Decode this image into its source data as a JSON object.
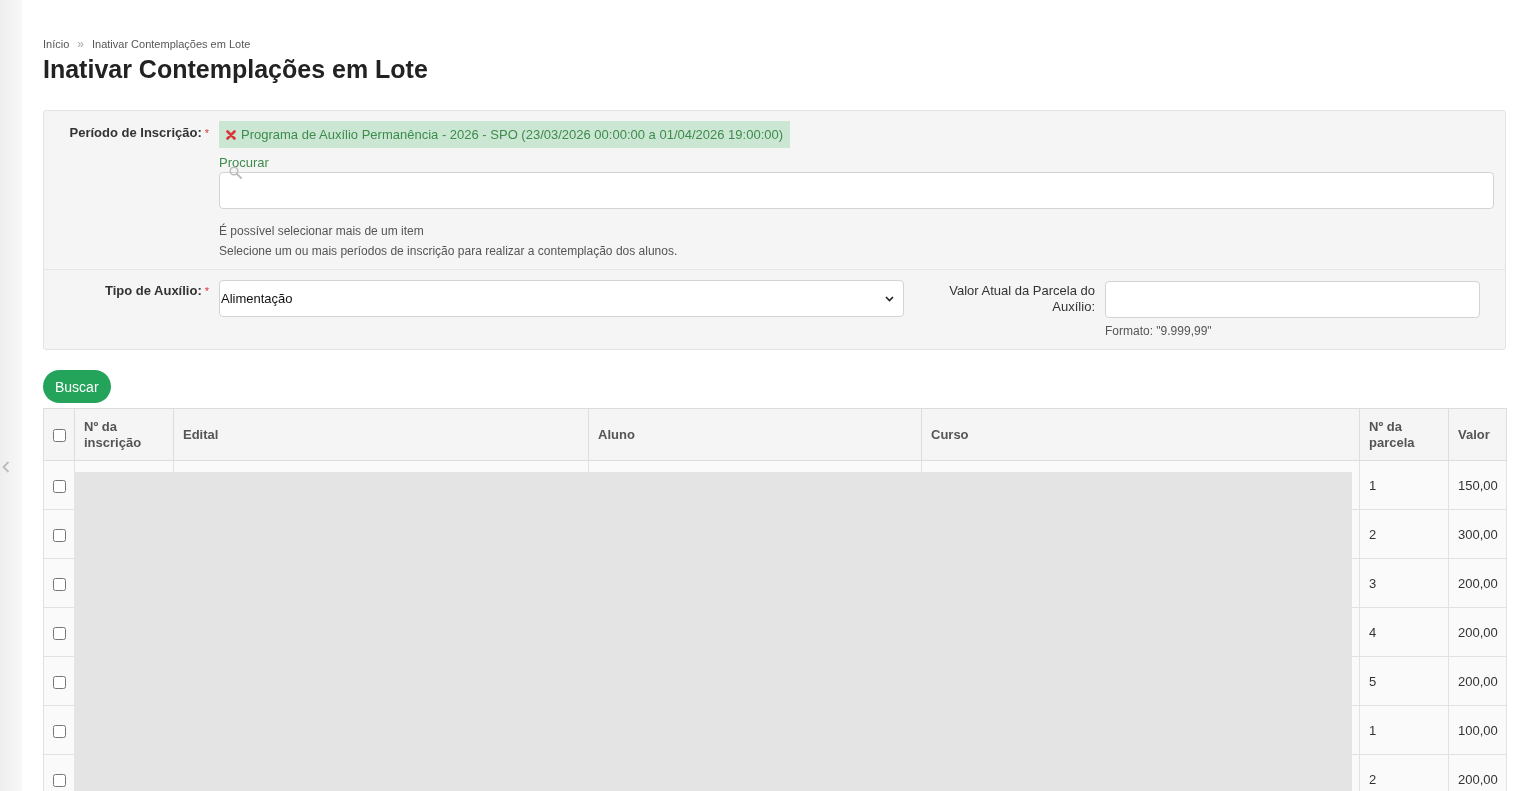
{
  "breadcrumb": {
    "items": [
      {
        "label": "Início"
      },
      {
        "label": "Inativar Contemplações em Lote"
      }
    ],
    "separator": "»"
  },
  "title": "Inativar Contemplações em Lote",
  "filters": {
    "enrollment_period": {
      "label": "Período de Inscrição:",
      "required_mark": "*",
      "selected": [
        {
          "text": "Programa de Auxílio Permanência - 2026 - SPO (23/03/2026 00:00:00 a 01/04/2026 19:00:00)"
        }
      ],
      "search": {
        "label": "Procurar"
      },
      "help": [
        "É possível selecionar mais de um item",
        "Selecione um ou mais períodos de inscrição para realizar a contemplação dos alunos."
      ]
    },
    "aid_type": {
      "label": "Tipo de Auxílio:",
      "required_mark": "*",
      "value": "Alimentação"
    },
    "installment_value": {
      "label": "Valor Atual da Parcela do Auxílio:",
      "help": "Formato: \"9.999,99\""
    }
  },
  "search_button": {
    "label": "Buscar"
  },
  "table": {
    "select_all": {
      "checked": false
    },
    "columns": [
      {
        "label": "Nº da inscrição"
      },
      {
        "label": "Edital"
      },
      {
        "label": "Aluno"
      },
      {
        "label": "Curso"
      },
      {
        "label": "Nº da parcela"
      },
      {
        "label": "Valor"
      }
    ],
    "rows": [
      {
        "checked": false,
        "installment": "1",
        "amount": "150,00"
      },
      {
        "checked": false,
        "installment": "2",
        "amount": "300,00"
      },
      {
        "checked": false,
        "installment": "3",
        "amount": "200,00"
      },
      {
        "checked": false,
        "installment": "4",
        "amount": "200,00"
      },
      {
        "checked": false,
        "installment": "5",
        "amount": "200,00"
      },
      {
        "checked": false,
        "installment": "1",
        "amount": "100,00"
      },
      {
        "checked": false,
        "installment": "2",
        "amount": "200,00"
      }
    ]
  }
}
